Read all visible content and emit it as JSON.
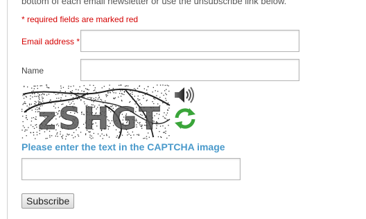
{
  "intro_text": "bottom of each email newsletter or use the unsubscribe link below.",
  "required_note": "* required fields are marked red",
  "fields": {
    "email_label": "Email address *",
    "email_value": "",
    "name_label": "Name",
    "name_value": ""
  },
  "captcha": {
    "image_text": "zSHGT",
    "prompt": "Please enter the text in the CAPTCHA image",
    "input_value": "",
    "audio_icon": "speaker-icon",
    "refresh_icon": "refresh-icon"
  },
  "submit_label": "Subscribe",
  "colors": {
    "required": "#d40000",
    "prompt": "#4a9acb",
    "refresh": "#3aa53a"
  }
}
